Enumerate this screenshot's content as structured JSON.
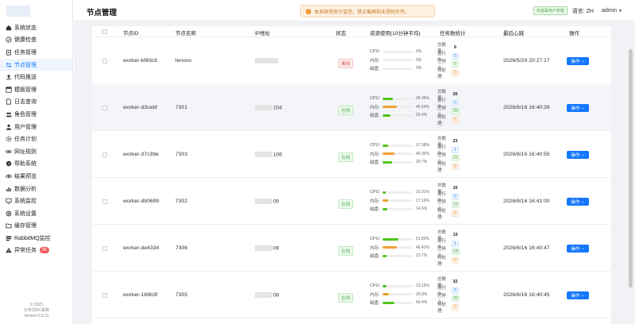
{
  "sidebar": {
    "items": [
      {
        "label": "系统状态",
        "icon": "home-icon"
      },
      {
        "label": "健康检查",
        "icon": "check-circle-icon"
      },
      {
        "label": "任务管理",
        "icon": "clipboard-icon"
      },
      {
        "label": "节点管理",
        "icon": "sliders-icon",
        "active": true
      },
      {
        "label": "代码推送",
        "icon": "upload-icon"
      },
      {
        "label": "模板管理",
        "icon": "template-icon"
      },
      {
        "label": "日志查询",
        "icon": "document-icon"
      },
      {
        "label": "角色管理",
        "icon": "people-icon"
      },
      {
        "label": "用户管理",
        "icon": "user-icon"
      },
      {
        "label": "任务计划",
        "icon": "gear-icon"
      },
      {
        "label": "网址规则",
        "icon": "link-icon"
      },
      {
        "label": "帮助系统",
        "icon": "help-icon"
      },
      {
        "label": "结果预览",
        "icon": "eye-icon"
      },
      {
        "label": "数据分析",
        "icon": "chart-icon"
      },
      {
        "label": "系统监控",
        "icon": "monitor-icon"
      },
      {
        "label": "系统设置",
        "icon": "settings-icon"
      },
      {
        "label": "缓存管理",
        "icon": "folder-icon"
      },
      {
        "label": "RabbitMQ监控",
        "icon": "queue-icon"
      },
      {
        "label": "异常任务",
        "icon": "warning-icon",
        "badge": "95"
      }
    ],
    "footer": {
      "line1": "© 2025",
      "line2": "分布式NC系统",
      "line3": "Version 6.5.11"
    }
  },
  "header": {
    "title": "节点管理",
    "notice": "本系统受审计监控，禁止截屏和未授权外传。",
    "tag": "该首属用户管理",
    "language": "语言: ZH",
    "user": "admin"
  },
  "table": {
    "columns": {
      "id": "节点ID",
      "name": "节点名称",
      "ip": "IP地址",
      "status": "状态",
      "resources": "资源使用(10分钟平均)",
      "tasks": "任务数统计",
      "heartbeat": "最后心跳",
      "actions": "操作"
    },
    "labels": {
      "cpu": "CPU:",
      "mem": "内存:",
      "disk": "磁盘:",
      "total": "总数量:",
      "running": "运行中:",
      "finished": "已停止:",
      "waiting": "待处理:",
      "action_button": "操作"
    },
    "rows": [
      {
        "id": "worker-bf83c8",
        "name": "lenovo",
        "ip": "",
        "status": "离线",
        "online": false,
        "cpu": "0%",
        "cpu_val": 0,
        "mem": "0%",
        "mem_val": 0,
        "disk": "0%",
        "disk_val": 0,
        "total": "6",
        "running": "0",
        "finished": "6",
        "waiting": "0",
        "heartbeat": "2026/5/29 20:27:17"
      },
      {
        "id": "worker-d3cebf",
        "name": "7301",
        "ip": "104",
        "status": "在线",
        "online": true,
        "cpu": "34.36%",
        "cpu_val": 34.36,
        "mem": "46.54%",
        "mem_val": 46.54,
        "disk": "25.4%",
        "disk_val": 25.4,
        "total": "26",
        "running": "0",
        "finished": "26",
        "waiting": "0",
        "heartbeat": "2026/8/16 16:40:39"
      },
      {
        "id": "worker-37c39e",
        "name": "7303",
        "ip": "106",
        "status": "在线",
        "online": true,
        "cpu": "17.38%",
        "cpu_val": 17.38,
        "mem": "40.32%",
        "mem_val": 40.32,
        "disk": "30.7%",
        "disk_val": 30.7,
        "total": "23",
        "running": "1",
        "finished": "22",
        "waiting": "0",
        "heartbeat": "2026/8/16 16:40:55"
      },
      {
        "id": "worker-db0699",
        "name": "7302",
        "ip": "05",
        "status": "在线",
        "online": true,
        "cpu": "10.31%",
        "cpu_val": 10.31,
        "mem": "17.16%",
        "mem_val": 17.16,
        "disk": "14.6%",
        "disk_val": 14.6,
        "total": "16",
        "running": "0",
        "finished": "16",
        "waiting": "0",
        "heartbeat": "2026/8/16 16:41:00"
      },
      {
        "id": "worker-de4334",
        "name": "7306",
        "ip": "09",
        "status": "在线",
        "online": true,
        "cpu": "51.83%",
        "cpu_val": 51.83,
        "mem": "46.41%",
        "mem_val": 46.41,
        "disk": "13.7%",
        "disk_val": 13.7,
        "total": "19",
        "running": "1",
        "finished": "18",
        "waiting": "0",
        "heartbeat": "2026/8/16 16:40:47"
      },
      {
        "id": "worker-186b3f",
        "name": "7305",
        "ip": "08",
        "status": "在线",
        "online": true,
        "cpu": "13.15%",
        "cpu_val": 13.15,
        "mem": "20.9%",
        "mem_val": 20.9,
        "disk": "40.4%",
        "disk_val": 40.4,
        "total": "32",
        "running": "0",
        "finished": "32",
        "waiting": "0",
        "heartbeat": "2026/8/16 16:40:45"
      }
    ]
  },
  "colors": {
    "primary": "#1677ff",
    "cpu_bar": "#52c41a",
    "mem_bar": "#f0a030",
    "offline": "#e05555",
    "online": "#52b352"
  }
}
